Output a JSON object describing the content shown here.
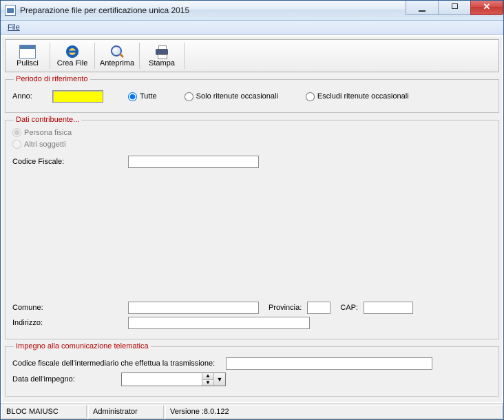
{
  "window": {
    "title": "Preparazione file per certificazione unica 2015"
  },
  "menu": {
    "file": "File"
  },
  "toolbar": {
    "pulisci": "Pulisci",
    "creafile": "Crea File",
    "anteprima": "Anteprima",
    "stampa": "Stampa"
  },
  "fs_periodo": {
    "legend": "Periodo di riferimento",
    "anno_label": "Anno:",
    "anno_value": "",
    "opt_tutte": "Tutte",
    "opt_solo": "Solo ritenute occasionali",
    "opt_escludi": "Escludi ritenute occasionali"
  },
  "fs_dati": {
    "legend": "Dati contribuente...",
    "persona_fisica": "Persona fisica",
    "altri_soggetti": "Altri soggetti",
    "codice_fiscale_label": "Codice Fiscale:",
    "codice_fiscale_value": "",
    "comune_label": "Comune:",
    "comune_value": "",
    "provincia_label": "Provincia:",
    "provincia_value": "",
    "cap_label": "CAP:",
    "cap_value": "",
    "indirizzo_label": "Indirizzo:",
    "indirizzo_value": ""
  },
  "fs_impegno": {
    "legend": "Impegno alla comunicazione telematica",
    "cf_intermediario_label": "Codice fiscale dell'intermediario che effettua la trasmissione:",
    "cf_intermediario_value": "",
    "data_impegno_label": "Data dell'impegno:",
    "data_impegno_value": ""
  },
  "status": {
    "capslock": "BLOC MAIUSC",
    "user": "Administrator",
    "version": "Versione :8.0.122"
  }
}
